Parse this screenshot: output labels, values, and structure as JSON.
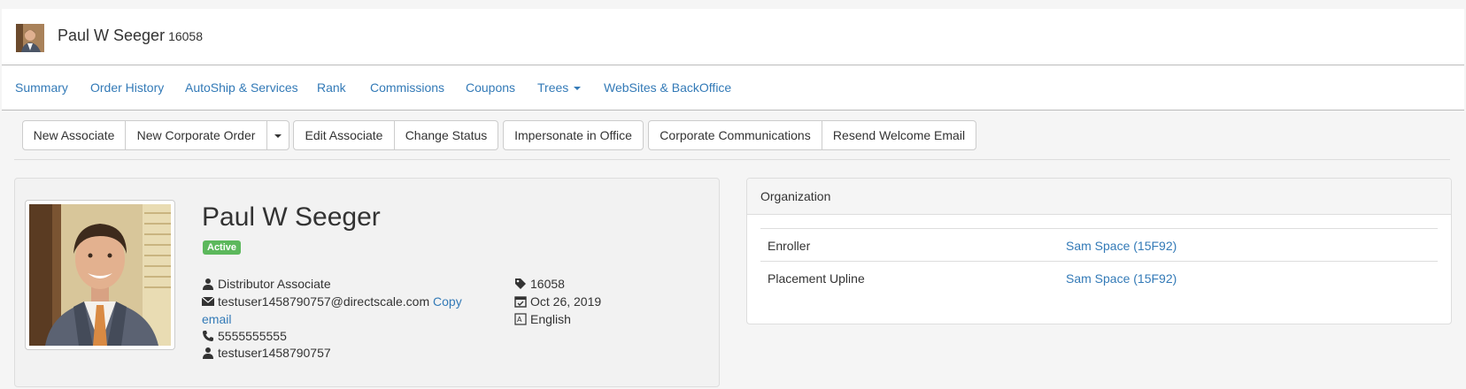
{
  "header": {
    "name": "Paul W Seeger",
    "id": "16058"
  },
  "nav": {
    "items": [
      {
        "label": "Summary"
      },
      {
        "label": "Order History"
      },
      {
        "label": "AutoShip & Services"
      },
      {
        "label": "Rank"
      },
      {
        "label": "Commissions"
      },
      {
        "label": "Coupons"
      },
      {
        "label": "Trees"
      },
      {
        "label": "WebSites & BackOffice"
      }
    ]
  },
  "toolbar": {
    "new_associate": "New Associate",
    "new_corporate_order": "New Corporate Order",
    "edit_associate": "Edit Associate",
    "change_status": "Change Status",
    "impersonate": "Impersonate in Office",
    "corporate_communications": "Corporate Communications",
    "resend_welcome": "Resend Welcome Email"
  },
  "profile": {
    "name": "Paul W Seeger",
    "status": "Active",
    "status_color": "#5cb85c",
    "type": "Distributor Associate",
    "email": "testuser1458790757@directscale.com",
    "copy_label_1": "Copy",
    "copy_label_2": "email",
    "phone": "5555555555",
    "username": "testuser1458790757",
    "id_tag": "16058",
    "date": "Oct 26, 2019",
    "language": "English"
  },
  "organization": {
    "title": "Organization",
    "rows": [
      {
        "label": "Enroller",
        "value": "Sam Space (15F92)"
      },
      {
        "label": "Placement Upline",
        "value": "Sam Space (15F92)"
      }
    ]
  },
  "colors": {
    "link": "#337ab7",
    "badge_active": "#5cb85c"
  }
}
